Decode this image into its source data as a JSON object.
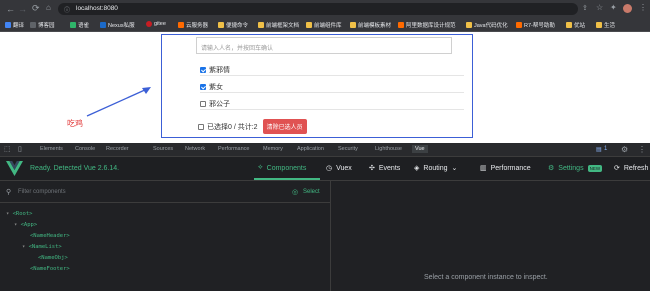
{
  "browser": {
    "url": "localhost:8080",
    "bookmarks": [
      {
        "label": "翻译",
        "color": "#4285f4"
      },
      {
        "label": "博客园",
        "color": "#5f6368"
      },
      {
        "label": "语雀",
        "color": "#2fb56a"
      },
      {
        "label": "Nexus私服",
        "color": "#1b6ac9"
      },
      {
        "label": "gitee",
        "color": "#c71d23"
      },
      {
        "label": "云服务器",
        "color": "#ff6a00"
      },
      {
        "label": "便捷命令",
        "color": "#f0c048"
      },
      {
        "label": "前端框架文档",
        "color": "#f0c048"
      },
      {
        "label": "前端组件库",
        "color": "#f0c048"
      },
      {
        "label": "前端模板素材",
        "color": "#f0c048"
      },
      {
        "label": "阿里数据库设计规范",
        "color": "#ff6a00"
      },
      {
        "label": "Java代码优化",
        "color": "#f0c048"
      },
      {
        "label": "R7-帮号助勒",
        "color": "#ff6a00"
      },
      {
        "label": "优站",
        "color": "#f0c048"
      },
      {
        "label": "生活",
        "color": "#f0c048"
      }
    ]
  },
  "demo": {
    "search_placeholder": "请输入人名，并按回车确认",
    "items": [
      {
        "name": "紫邪情",
        "checked": true
      },
      {
        "name": "紫女",
        "checked": true
      },
      {
        "name": "邪公子",
        "checked": false
      }
    ],
    "summary": "已选择0 / 共计:2",
    "delete_button": "清除已选人员",
    "annotation": "吃鸡"
  },
  "devtools": {
    "tabs": [
      "Elements",
      "Console",
      "Recorder",
      "Sources",
      "Network",
      "Performance",
      "Memory",
      "Application",
      "Security",
      "Lighthouse",
      "Vue"
    ],
    "issue_count": "1",
    "vue": {
      "status": "Ready. Detected Vue 2.6.14.",
      "nav": [
        "Components",
        "Vuex",
        "Events",
        "Routing",
        "Performance",
        "Settings",
        "Refresh"
      ],
      "new_badge": "NEW",
      "filter_placeholder": "Filter components",
      "select_label": "Select",
      "tree": [
        "<Root>",
        "<App>",
        "<NameHeader>",
        "<NameList>",
        "<NameObj>",
        "<NameFooter>"
      ],
      "inspect_hint": "Select a component instance to inspect."
    }
  },
  "colors": {
    "vue_green": "#42b883",
    "accent_blue": "#3c5fd6",
    "danger": "#e05252"
  }
}
